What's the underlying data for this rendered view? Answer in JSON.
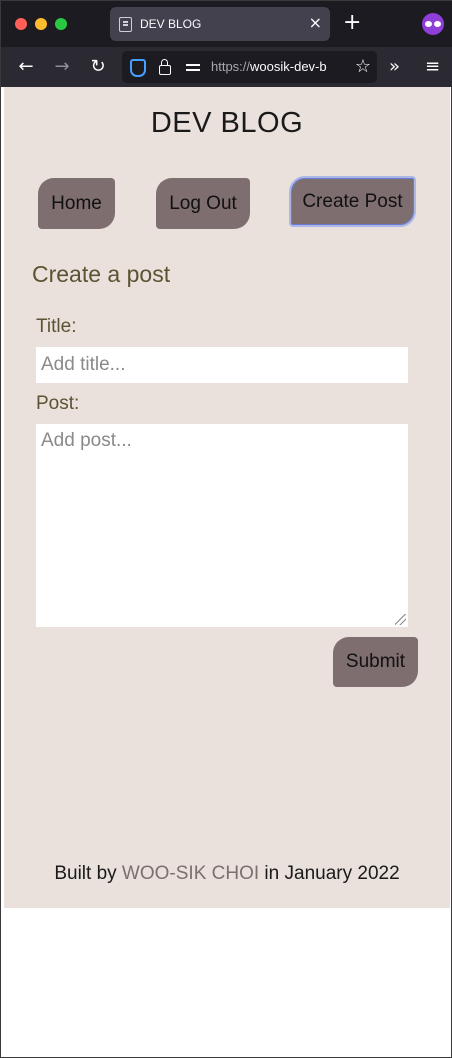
{
  "browser": {
    "tab_title": "DEV BLOG",
    "tab_close": "×",
    "new_tab": "+",
    "url_scheme": "https://",
    "url_host": "woosik-dev-b",
    "back": "←",
    "forward": "→",
    "reload": "↻",
    "bookmark": "☆",
    "overflow": "»",
    "menu": "≡"
  },
  "site": {
    "title": "DEV BLOG"
  },
  "nav": {
    "home": "Home",
    "logout": "Log Out",
    "create_post": "Create Post"
  },
  "form": {
    "heading": "Create a post",
    "title_label": "Title:",
    "title_placeholder": "Add title...",
    "post_label": "Post:",
    "post_placeholder": "Add post...",
    "submit": "Submit"
  },
  "footer": {
    "prefix": "Built by ",
    "author": "WOO-SIK CHOI",
    "suffix": " in January 2022"
  },
  "colors": {
    "page_bg": "#eae0dc",
    "button_bg": "#7e6e6f",
    "heading_color": "#5b5432"
  }
}
